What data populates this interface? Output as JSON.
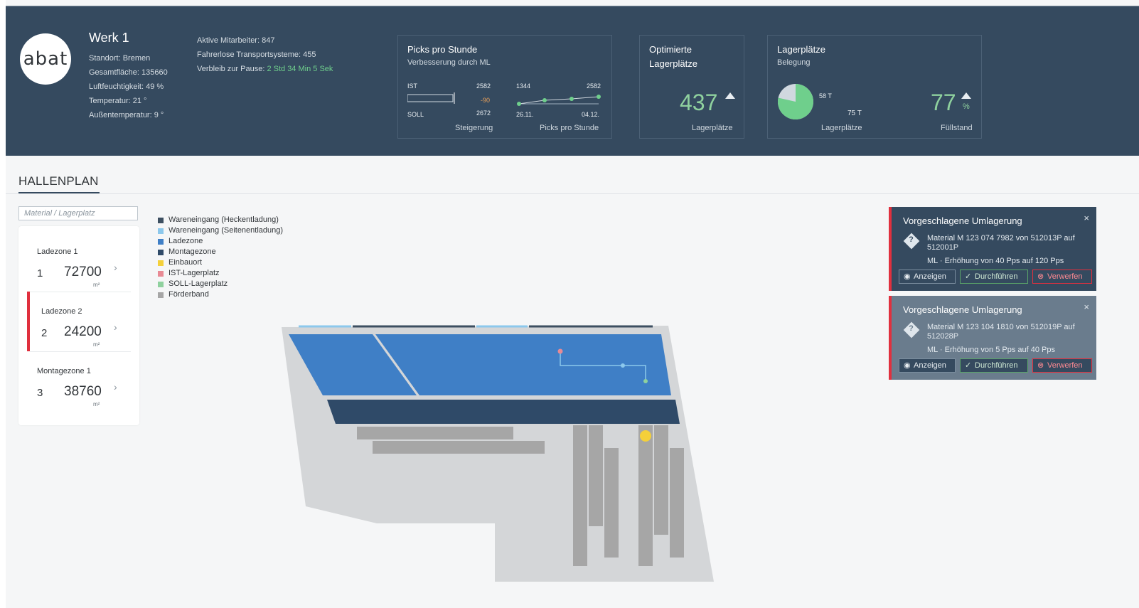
{
  "header": {
    "logo": "abat",
    "plant": {
      "title": "Werk 1",
      "lines": [
        "Standort: Bremen",
        "Gesamtfläche: 135660",
        "Luftfeuchtigkeit: 49 %",
        "Temperatur: 21 °",
        "Außentemperatur: 9 °"
      ]
    },
    "stats": {
      "employees": "Aktive Mitarbeiter: 847",
      "agv": "Fahrerlose Transportsysteme: 455",
      "pause_label": "Verbleib zur Pause:",
      "pause_value": "2 Std 34 Min 5 Sek"
    },
    "tile_picks": {
      "title": "Picks pro Stunde",
      "subtitle": "Verbesserung durch ML",
      "ist_label": "IST",
      "ist_value": "2582",
      "delta": "-90",
      "soll_label": "SOLL",
      "soll_value": "2672",
      "footer_left": "Steigerung",
      "spark_start": "1344",
      "spark_end": "2582",
      "date_start": "26.11.",
      "date_end": "04.12.",
      "footer_right": "Picks pro Stunde"
    },
    "tile_opt": {
      "title_line1": "Optimierte",
      "title_line2": "Lagerplätze",
      "value": "437",
      "footer": "Lagerplätze"
    },
    "tile_lager": {
      "title": "Lagerplätze",
      "subtitle": "Belegung",
      "pie_value": "58 T",
      "pie_total": "75 T",
      "footer_left": "Lagerplätze",
      "percent": "77",
      "percent_unit": "%",
      "footer_right": "Füllstand"
    }
  },
  "section": {
    "title": "HALLENPLAN"
  },
  "search": {
    "placeholder": "Material / Lagerplatz"
  },
  "zones": [
    {
      "label": "Ladezone 1",
      "num": "1",
      "value": "72700",
      "unit": "m²"
    },
    {
      "label": "Ladezone 2",
      "num": "2",
      "value": "24200",
      "unit": "m²"
    },
    {
      "label": "Montagezone 1",
      "num": "3",
      "value": "38760",
      "unit": "m²"
    }
  ],
  "legend": [
    {
      "label": "Wareneingang (Heckentladung)",
      "color": "#3d4f61"
    },
    {
      "label": "Wareneingang (Seitenentladung)",
      "color": "#8cc8ec"
    },
    {
      "label": "Ladezone",
      "color": "#3f7fc6"
    },
    {
      "label": "Montagezone",
      "color": "#2f4a68"
    },
    {
      "label": "Einbauort",
      "color": "#f4d03a"
    },
    {
      "label": "IST-Lagerplatz",
      "color": "#e88a94"
    },
    {
      "label": "SOLL-Lagerplatz",
      "color": "#8fd19e"
    },
    {
      "label": "Förderband",
      "color": "#a6a6a6"
    }
  ],
  "cards": [
    {
      "title": "Vorgeschlagene Umlagerung",
      "close": "×",
      "text": "Material M 123 074 7982 von 512013P auf 512001P",
      "note": "ML  ·  Erhöhung von 40 Pps auf 120 Pps",
      "btn_show": "Anzeigen",
      "btn_do": "Durchführen",
      "btn_reject": "Verwerfen"
    },
    {
      "title": "Vorgeschlagene Umlagerung",
      "close": "×",
      "text": "Material M 123 104 1810 von 512019P auf 512028P",
      "note": "ML  ·  Erhöhung von 5 Pps auf 40 Pps",
      "btn_show": "Anzeigen",
      "btn_do": "Durchführen",
      "btn_reject": "Verwerfen"
    }
  ],
  "colors": {
    "header_bg": "#354a5f",
    "accent_red": "#e0303e",
    "accent_green": "#6fcf8c"
  }
}
